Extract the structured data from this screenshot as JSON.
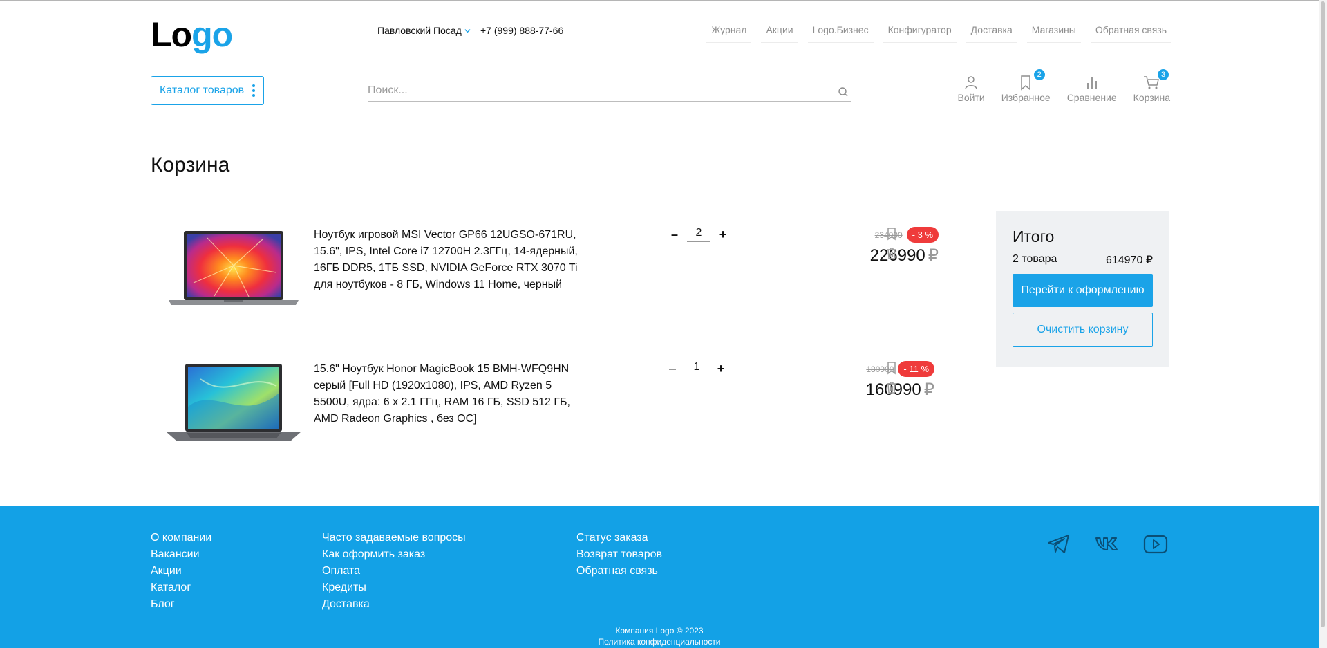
{
  "header": {
    "logo_part1": "Lo",
    "logo_part2": "go",
    "city": "Павловский Посад",
    "phone": "+7 (999) 888-77-66",
    "nav": [
      "Журнал",
      "Акции",
      "Logo.Бизнес",
      "Конфигуратор",
      "Доставка",
      "Магазины",
      "Обратная связь"
    ],
    "catalog_label": "Каталог товаров",
    "search_placeholder": "Поиск...",
    "icons": {
      "login": "Войти",
      "favorites": "Избранное",
      "favorites_count": "2",
      "compare": "Сравнение",
      "cart": "Корзина",
      "cart_count": "3"
    }
  },
  "page_title": "Корзина",
  "cart": {
    "items": [
      {
        "name": "Ноутбук игровой MSI Vector GP66 12UGSO-671RU, 15.6\", IPS, Intel Core i7 12700H 2.3ГГц, 14-ядерный, 16ГБ DDR5, 1ТБ SSD, NVIDIA GeForce RTX 3070 Ti для ноутбуков - 8 ГБ, Windows 11 Home, черный",
        "quantity": "2",
        "old_price": "234000",
        "discount": "- 3 %",
        "price": "226990",
        "currency": "₽"
      },
      {
        "name": "15.6\" Ноутбук Honor MagicBook 15 BMH-WFQ9HN серый [Full HD (1920x1080), IPS, AMD Ryzen 5 5500U, ядра: 6 х 2.1 ГГц, RAM 16 ГБ, SSD 512 ГБ, AMD Radeon Graphics , без ОС]",
        "quantity": "1",
        "old_price": "180900",
        "discount": "- 11 %",
        "price": "160990",
        "currency": "₽"
      }
    ],
    "minus": "–",
    "plus": "+"
  },
  "summary": {
    "title": "Итого",
    "count_label": "2 товара",
    "total": "614970 ₽",
    "checkout_label": "Перейти к оформлению",
    "clear_label": "Очистить корзину"
  },
  "footer": {
    "col1": [
      "О компании",
      "Вакансии",
      "Акции",
      "Каталог",
      "Блог"
    ],
    "col2": [
      "Часто задаваемые вопросы",
      "Как оформить заказ",
      "Оплата",
      "Кредиты",
      "Доставка"
    ],
    "col3": [
      "Статус заказа",
      "Возврат товаров",
      "Обратная связь"
    ],
    "copyright": "Компания Logo © 2023",
    "privacy": "Политика конфиденциальности"
  },
  "colors": {
    "accent": "#1aa3e8",
    "footer_bg": "#13a1e6",
    "discount_badge": "#ef3b3b",
    "summary_bg": "#eff1f3"
  }
}
